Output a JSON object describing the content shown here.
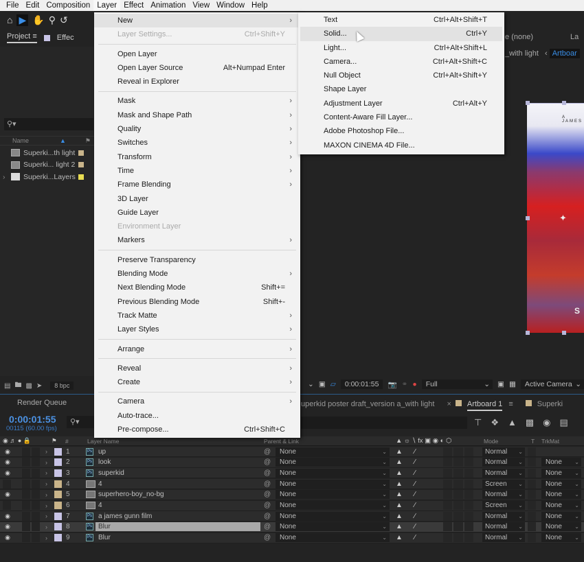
{
  "menubar": [
    "File",
    "Edit",
    "Composition",
    "Layer",
    "Effect",
    "Animation",
    "View",
    "Window",
    "Help"
  ],
  "active_menu": "Layer",
  "toolbar": {
    "icons": [
      "home-icon",
      "selection-tool-icon",
      "hand-tool-icon",
      "zoom-tool-icon",
      "rotate-tool-icon"
    ]
  },
  "project_panel": {
    "tab_label": "Project",
    "effect_tab_label": "Effec",
    "search_placeholder": "⌕",
    "name_header": "Name",
    "items": [
      {
        "name": "Superki...th light",
        "type": "composition",
        "label_color": "#c9b48a"
      },
      {
        "name": "Superki... light 2",
        "type": "composition",
        "label_color": "#c9b48a"
      },
      {
        "name": "Superki...Layers",
        "type": "folder",
        "label_color": "#e8dc52"
      }
    ],
    "bpc": "8 bpc"
  },
  "layer_menu": {
    "groups": [
      [
        {
          "label": "New",
          "submenu": true,
          "highlighted": true
        },
        {
          "label": "Layer Settings...",
          "shortcut": "Ctrl+Shift+Y",
          "disabled": true
        }
      ],
      [
        {
          "label": "Open Layer"
        },
        {
          "label": "Open Layer Source",
          "shortcut": "Alt+Numpad Enter"
        },
        {
          "label": "Reveal in Explorer"
        }
      ],
      [
        {
          "label": "Mask",
          "submenu": true
        },
        {
          "label": "Mask and Shape Path",
          "submenu": true
        },
        {
          "label": "Quality",
          "submenu": true
        },
        {
          "label": "Switches",
          "submenu": true
        },
        {
          "label": "Transform",
          "submenu": true
        },
        {
          "label": "Time",
          "submenu": true
        },
        {
          "label": "Frame Blending",
          "submenu": true
        },
        {
          "label": "3D Layer"
        },
        {
          "label": "Guide Layer"
        },
        {
          "label": "Environment Layer",
          "disabled": true
        },
        {
          "label": "Markers",
          "submenu": true
        }
      ],
      [
        {
          "label": "Preserve Transparency"
        },
        {
          "label": "Blending Mode",
          "submenu": true
        },
        {
          "label": "Next Blending Mode",
          "shortcut": "Shift+="
        },
        {
          "label": "Previous Blending Mode",
          "shortcut": "Shift+-"
        },
        {
          "label": "Track Matte",
          "submenu": true
        },
        {
          "label": "Layer Styles",
          "submenu": true
        }
      ],
      [
        {
          "label": "Arrange",
          "submenu": true
        }
      ],
      [
        {
          "label": "Reveal",
          "submenu": true
        },
        {
          "label": "Create",
          "submenu": true
        }
      ],
      [
        {
          "label": "Camera",
          "submenu": true
        },
        {
          "label": "Auto-trace..."
        },
        {
          "label": "Pre-compose...",
          "shortcut": "Ctrl+Shift+C"
        }
      ]
    ]
  },
  "new_submenu": [
    {
      "label": "Text",
      "shortcut": "Ctrl+Alt+Shift+T"
    },
    {
      "label": "Solid...",
      "shortcut": "Ctrl+Y",
      "highlighted": true
    },
    {
      "label": "Light...",
      "shortcut": "Ctrl+Alt+Shift+L"
    },
    {
      "label": "Camera...",
      "shortcut": "Ctrl+Alt+Shift+C"
    },
    {
      "label": "Null Object",
      "shortcut": "Ctrl+Alt+Shift+Y"
    },
    {
      "label": "Shape Layer"
    },
    {
      "label": "Adjustment Layer",
      "shortcut": "Ctrl+Alt+Y"
    },
    {
      "label": "Content-Aware Fill Layer..."
    },
    {
      "label": "Adobe Photoshop File..."
    },
    {
      "label": "MAXON CINEMA 4D File..."
    }
  ],
  "composition_panel": {
    "layer_label": "(none)",
    "breadcrumb_prev": "_with light",
    "breadcrumb_current": "Artboar",
    "poster_top_text": "A JAMES",
    "poster_bottom_text": "S"
  },
  "viewer_bar": {
    "timecode": "0:00:01:55",
    "resolution": "Full",
    "camera": "Active Camera"
  },
  "timeline": {
    "render_queue_label": "Render Queue",
    "current_time": "0:00:01:55",
    "frame_info": "00115 (60.00 fps)",
    "tabs": [
      {
        "label": "uperkid poster draft_version a_with light",
        "active": false
      },
      {
        "label": "Artboard 1",
        "active": true,
        "color": "#c9b48a"
      },
      {
        "label": "Superki",
        "active": false,
        "color": "#c9b48a"
      }
    ],
    "headers": {
      "num": "#",
      "layer_name": "Layer Name",
      "parent": "Parent & Link",
      "mode": "Mode",
      "t": "T",
      "trkmat": "TrkMat"
    },
    "layers": [
      {
        "num": "1",
        "name": "up",
        "type": "psd",
        "visible": true,
        "label": "#c8c4e6",
        "parent": "None",
        "mode": "Normal",
        "trkmat": ""
      },
      {
        "num": "2",
        "name": "look",
        "type": "psd",
        "visible": true,
        "label": "#c8c4e6",
        "parent": "None",
        "mode": "Normal",
        "trkmat": "None"
      },
      {
        "num": "3",
        "name": "superkid",
        "type": "psd",
        "visible": true,
        "label": "#c8c4e6",
        "parent": "None",
        "mode": "Normal",
        "trkmat": "None"
      },
      {
        "num": "4",
        "name": "4",
        "type": "image",
        "visible": false,
        "label": "#c9b48a",
        "parent": "None",
        "mode": "Screen",
        "trkmat": "None"
      },
      {
        "num": "5",
        "name": "superhero-boy_no-bg",
        "type": "image",
        "visible": true,
        "label": "#c9b48a",
        "parent": "None",
        "mode": "Normal",
        "trkmat": "None"
      },
      {
        "num": "6",
        "name": "4",
        "type": "image",
        "visible": false,
        "label": "#c9b48a",
        "parent": "None",
        "mode": "Screen",
        "trkmat": "None"
      },
      {
        "num": "7",
        "name": "a james    gunn film",
        "type": "psd",
        "visible": true,
        "label": "#c8c4e6",
        "parent": "None",
        "mode": "Normal",
        "trkmat": "None"
      },
      {
        "num": "8",
        "name": "Blur",
        "type": "psd",
        "visible": true,
        "label": "#c8c4e6",
        "parent": "None",
        "mode": "Normal",
        "trkmat": "None",
        "selected": true
      },
      {
        "num": "9",
        "name": "Blur",
        "type": "psd",
        "visible": true,
        "label": "#c8c4e6",
        "parent": "None",
        "mode": "Normal",
        "trkmat": "None"
      }
    ]
  }
}
